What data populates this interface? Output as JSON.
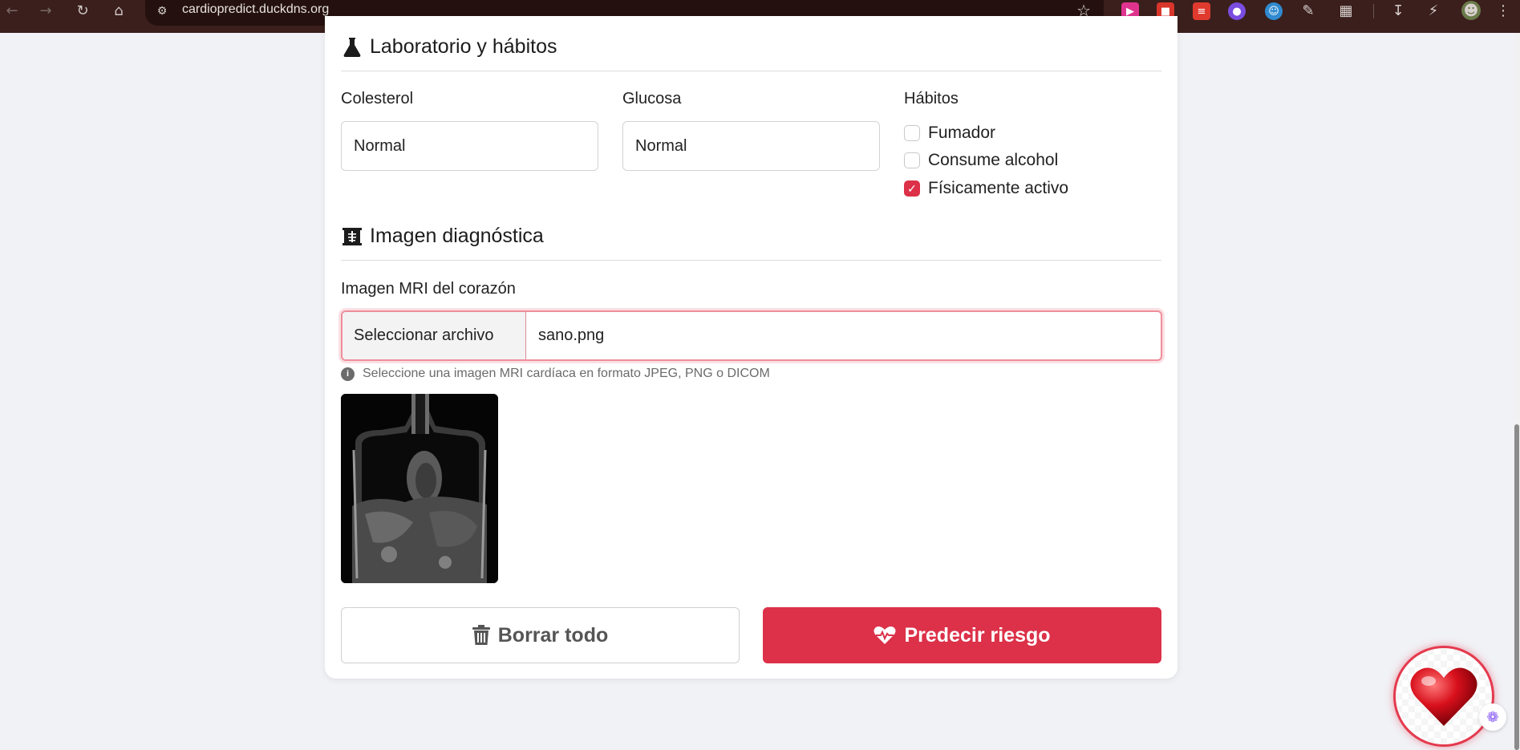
{
  "browser": {
    "url": "cardiopredict.duckdns.org"
  },
  "lab_section": {
    "title": "Laboratorio y hábitos",
    "cholesterol": {
      "label": "Colesterol",
      "value": "Normal"
    },
    "glucose": {
      "label": "Glucosa",
      "value": "Normal"
    },
    "habits": {
      "label": "Hábitos",
      "items": [
        {
          "label": "Fumador",
          "checked": false
        },
        {
          "label": "Consume alcohol",
          "checked": false
        },
        {
          "label": "Físicamente activo",
          "checked": true
        }
      ]
    }
  },
  "imaging_section": {
    "title": "Imagen diagnóstica",
    "mri_label": "Imagen MRI del corazón",
    "file_button": "Seleccionar archivo",
    "file_name": "sano.png",
    "hint": "Seleccione una imagen MRI cardíaca en formato JPEG, PNG o DICOM"
  },
  "actions": {
    "clear_label": "Borrar todo",
    "predict_label": "Predecir riesgo"
  },
  "colors": {
    "accent": "#dc3149",
    "chrome": "#3a1f1c"
  }
}
